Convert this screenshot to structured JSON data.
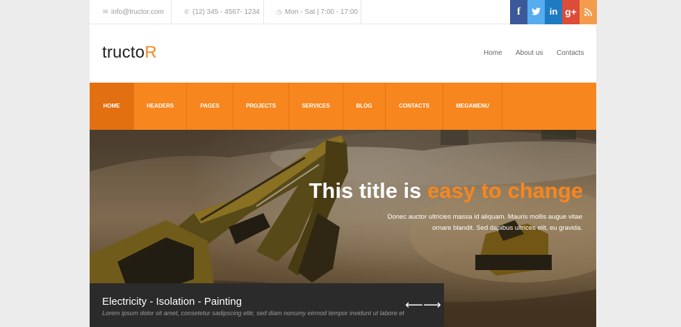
{
  "topbar": {
    "email": "info@tructor.com",
    "phone": "(12) 345 - 4567- 1234",
    "hours": "Mon - Sat | 7:00 - 17:00",
    "email_icon": "envelope-icon",
    "phone_icon": "phone-icon",
    "hours_icon": "clock-icon"
  },
  "social": [
    {
      "name": "facebook",
      "glyph": "f",
      "color": "#3b5998"
    },
    {
      "name": "twitter",
      "glyph": "t",
      "color": "#55acee"
    },
    {
      "name": "linkedin",
      "glyph": "in",
      "color": "#1f7bc1"
    },
    {
      "name": "google-plus",
      "glyph": "g+",
      "color": "#dd4b39"
    },
    {
      "name": "rss",
      "glyph": "ʟ",
      "color": "#f39c4c"
    }
  ],
  "logo": {
    "main": "tructo",
    "accent": "R"
  },
  "topnav": {
    "home": "Home",
    "about": "About us",
    "contacts": "Contacts"
  },
  "menu": {
    "items": [
      "HOME",
      "HEADERS",
      "PAGES",
      "PROJECTS",
      "SERVICES",
      "BLOG",
      "CONTACTS",
      "MEGAMENU"
    ],
    "active": "HOME",
    "color": "#f7861e"
  },
  "hero": {
    "title_main": "This title is ",
    "title_accent": "easy to change",
    "subtitle_line1": "Donec auctor ultricies massa id aliquam. Mauris mollis augue vitae",
    "subtitle_line2": "ornare blandit. Sed dapibus ultrices elit, eu gravida."
  },
  "caption": {
    "title": "Electricity - Isolation - Painting",
    "text": "Lorem ipsum dolor sit amet, consetetur sadipscing elitr, sed diam nonumy eirmod tempor invidunt ut labore et",
    "prev": "⟵",
    "next": "⟶"
  }
}
